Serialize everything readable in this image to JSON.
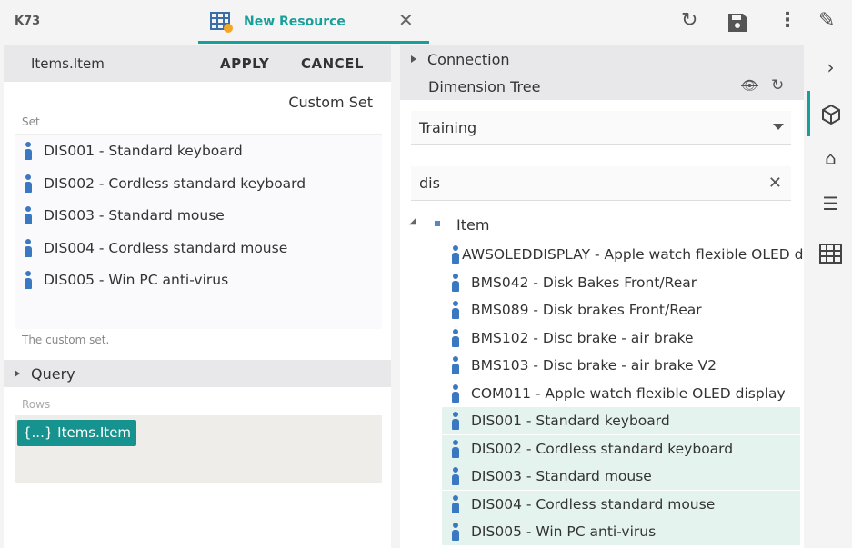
{
  "app": {
    "title": "K73"
  },
  "tab": {
    "label": "New Resource",
    "icon": "table-icon",
    "badge_color": "#f5a623",
    "accent": "#17a09a"
  },
  "toolbar": {
    "refresh": "refresh-icon",
    "save": "save-icon",
    "more": "more-vert-icon",
    "edit": "pencil-icon"
  },
  "left": {
    "header": "Items.Item",
    "apply": "APPLY",
    "cancel": "CANCEL",
    "type_label": "Custom Set",
    "set_label": "Set",
    "set_items": [
      "DIS001 - Standard keyboard",
      "DIS002 - Cordless standard keyboard",
      "DIS003 - Standard mouse",
      "DIS004 - Cordless standard mouse",
      "DIS005 - Win PC anti-virus"
    ],
    "help": "The custom set.",
    "query": "Query",
    "rows_label": "Rows",
    "chip": "{...} Items.Item"
  },
  "right": {
    "connection": "Connection",
    "dimension_tree": "Dimension Tree",
    "select_value": "Training",
    "search_value": "dis",
    "root": "Item",
    "items": [
      {
        "label": "AWSOLEDDISPLAY - Apple watch flexible OLED display",
        "selected": false
      },
      {
        "label": "BMS042 - Disk Bakes Front/Rear",
        "selected": false
      },
      {
        "label": "BMS089 - Disk brakes Front/Rear",
        "selected": false
      },
      {
        "label": "BMS102 - Disc brake - air brake",
        "selected": false
      },
      {
        "label": "BMS103 - Disc brake - air brake V2",
        "selected": false
      },
      {
        "label": "COM011 - Apple watch flexible OLED display",
        "selected": false
      },
      {
        "label": "DIS001 - Standard keyboard",
        "selected": true
      },
      {
        "label": "DIS002 - Cordless standard keyboard",
        "selected": true
      },
      {
        "label": "DIS003 - Standard mouse",
        "selected": true
      },
      {
        "label": "DIS004 - Cordless standard mouse",
        "selected": true
      },
      {
        "label": "DIS005 - Win PC anti-virus",
        "selected": true
      }
    ]
  },
  "sidebar": [
    "chevron-right-icon",
    "cube-icon",
    "home-icon",
    "list-icon",
    "grid-icon"
  ]
}
